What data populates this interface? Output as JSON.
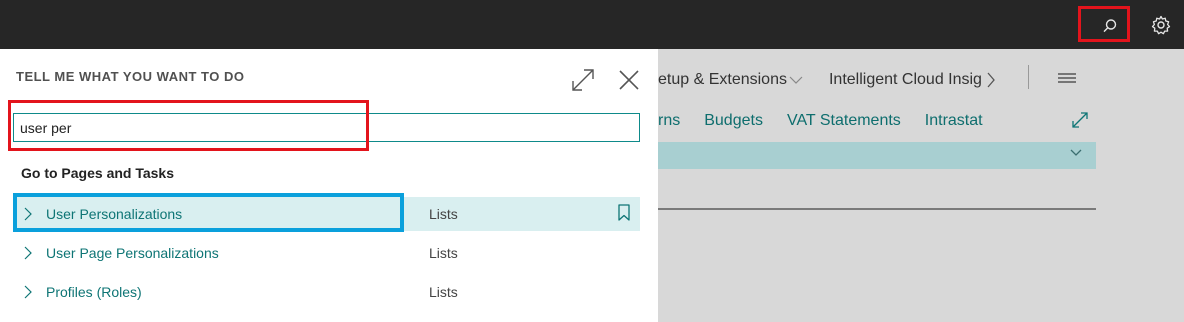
{
  "topbar": {
    "search_icon": "search-icon",
    "settings_icon": "gear-icon"
  },
  "background": {
    "nav_items": [
      "etup & Extensions",
      "Intelligent Cloud Insig"
    ],
    "tabs": [
      "rns",
      "Budgets",
      "VAT Statements",
      "Intrastat"
    ]
  },
  "panel": {
    "title": "TELL ME WHAT YOU WANT TO DO",
    "search_value": "user per",
    "section_heading": "Go to Pages and Tasks",
    "results": [
      {
        "name": "User Personalizations",
        "type": "Lists"
      },
      {
        "name": "User Page Personalizations",
        "type": "Lists"
      },
      {
        "name": "Profiles (Roles)",
        "type": "Lists"
      }
    ]
  },
  "colors": {
    "topbar": "#262626",
    "accent_teal": "#0e7575",
    "highlight_red": "#e3141c",
    "highlight_blue": "#0aa0dc",
    "selected_row": "#d9eff0"
  }
}
